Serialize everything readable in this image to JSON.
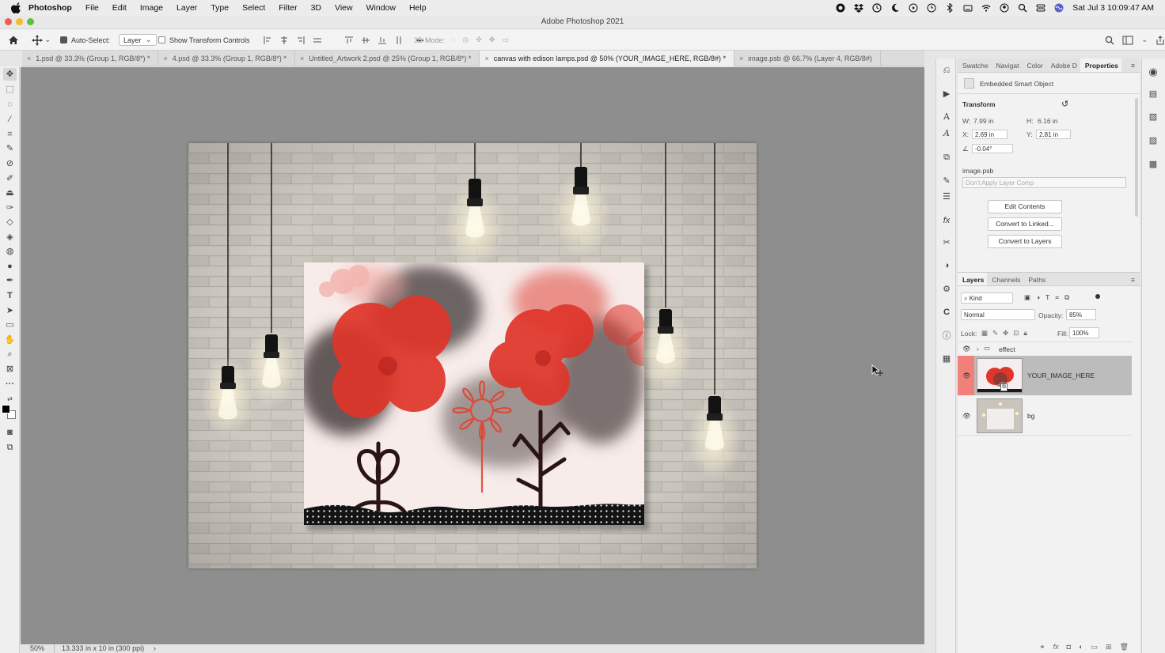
{
  "menubar": {
    "app": "Photoshop",
    "items": [
      "File",
      "Edit",
      "Image",
      "Layer",
      "Type",
      "Select",
      "Filter",
      "3D",
      "View",
      "Window",
      "Help"
    ],
    "datetime": "Sat Jul 3  10:09:47 AM"
  },
  "window": {
    "title": "Adobe Photoshop 2021"
  },
  "options": {
    "auto_select_label": "Auto-Select:",
    "auto_select_value": "Layer",
    "transform_controls_label": "Show Transform Controls",
    "mode_3d_label": "3D Mode:"
  },
  "tabs": [
    {
      "label": "1.psd @ 33.3% (Group 1, RGB/8*) *"
    },
    {
      "label": "4.psd @ 33.3% (Group 1, RGB/8*) *"
    },
    {
      "label": "Untitled_Artwork 2.psd @ 25% (Group 1, RGB/8*) *"
    },
    {
      "label": "canvas with edison lamps.psd @ 50% (YOUR_IMAGE_HERE, RGB/8#) *"
    },
    {
      "label": "image.psb @ 66.7% (Layer 4, RGB/8#)"
    }
  ],
  "status": {
    "zoom": "50%",
    "doc_size": "13.333 in x 10 in (300 ppi)"
  },
  "panel_tabs": [
    "Swatche",
    "Navigat",
    "Color",
    "Adobe D",
    "Properties"
  ],
  "properties": {
    "object_type": "Embedded Smart Object",
    "section": "Transform",
    "w_label": "W:",
    "w_value": "7.99 in",
    "h_label": "H:",
    "h_value": "6.16 in",
    "x_label": "X:",
    "x_value": "2.69 in",
    "y_label": "Y:",
    "y_value": "2.81 in",
    "angle_value": "-0.04°",
    "source_file": "image.psb",
    "layer_comp": "Don't Apply Layer Comp",
    "btn_edit": "Edit Contents",
    "btn_convert_linked": "Convert to Linked...",
    "btn_convert_layers": "Convert to Layers"
  },
  "layers_panel": {
    "tabs": [
      "Layers",
      "Channels",
      "Paths"
    ],
    "filter": "Kind",
    "blend_mode": "Normal",
    "opacity_label": "Opacity:",
    "opacity": "85%",
    "lock_label": "Lock:",
    "fill_label": "Fill:",
    "fill": "100%",
    "layers": [
      {
        "name": "effect",
        "type": "group"
      },
      {
        "name": "YOUR_IMAGE_HERE",
        "type": "smart",
        "selected": true
      },
      {
        "name": "bg",
        "type": "pixel"
      }
    ]
  },
  "colors": {
    "accent_selected": "#f1807a",
    "canvas_bg": "#8e8e8e",
    "poppy_red": "#e0352a"
  },
  "icons": [
    "apple-icon",
    "home-icon",
    "move-icon",
    "search-icon",
    "eye-icon",
    "folder-icon",
    "lock-icon",
    "trash-icon"
  ]
}
